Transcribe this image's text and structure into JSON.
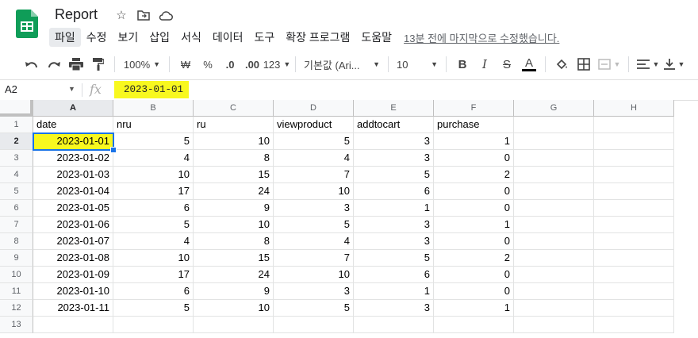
{
  "app": {
    "title": "Report",
    "last_edit": "13분 전에 마지막으로 수정했습니다."
  },
  "menu": [
    "파일",
    "수정",
    "보기",
    "삽입",
    "서식",
    "데이터",
    "도구",
    "확장 프로그램",
    "도움말"
  ],
  "toolbar": {
    "zoom": "100%",
    "currency": "₩",
    "percent": "%",
    "dec_decrease": ".0",
    "dec_increase": ".00",
    "number_format": "123",
    "font": "기본값 (Ari...",
    "font_size": "10",
    "bold": "B",
    "italic": "I",
    "strike": "S",
    "text_color": "A"
  },
  "formula_bar": {
    "name_box": "A2",
    "fx": "fx",
    "value": "2023-01-01"
  },
  "grid": {
    "columns": [
      "A",
      "B",
      "C",
      "D",
      "E",
      "F",
      "G",
      "H"
    ],
    "rows": [
      "1",
      "2",
      "3",
      "4",
      "5",
      "6",
      "7",
      "8",
      "9",
      "10",
      "11",
      "12",
      "13"
    ],
    "header": [
      "date",
      "nru",
      "ru",
      "viewproduct",
      "addtocart",
      "purchase"
    ],
    "data": [
      [
        "2023-01-01",
        "5",
        "10",
        "5",
        "3",
        "1"
      ],
      [
        "2023-01-02",
        "4",
        "8",
        "4",
        "3",
        "0"
      ],
      [
        "2023-01-03",
        "10",
        "15",
        "7",
        "5",
        "2"
      ],
      [
        "2023-01-04",
        "17",
        "24",
        "10",
        "6",
        "0"
      ],
      [
        "2023-01-05",
        "6",
        "9",
        "3",
        "1",
        "0"
      ],
      [
        "2023-01-06",
        "5",
        "10",
        "5",
        "3",
        "1"
      ],
      [
        "2023-01-07",
        "4",
        "8",
        "4",
        "3",
        "0"
      ],
      [
        "2023-01-08",
        "10",
        "15",
        "7",
        "5",
        "2"
      ],
      [
        "2023-01-09",
        "17",
        "24",
        "10",
        "6",
        "0"
      ],
      [
        "2023-01-10",
        "6",
        "9",
        "3",
        "1",
        "0"
      ],
      [
        "2023-01-11",
        "5",
        "10",
        "5",
        "3",
        "1"
      ]
    ],
    "selected_cell": "A2",
    "highlight_color": "#f8f81f",
    "selection_color": "#1a73e8"
  }
}
